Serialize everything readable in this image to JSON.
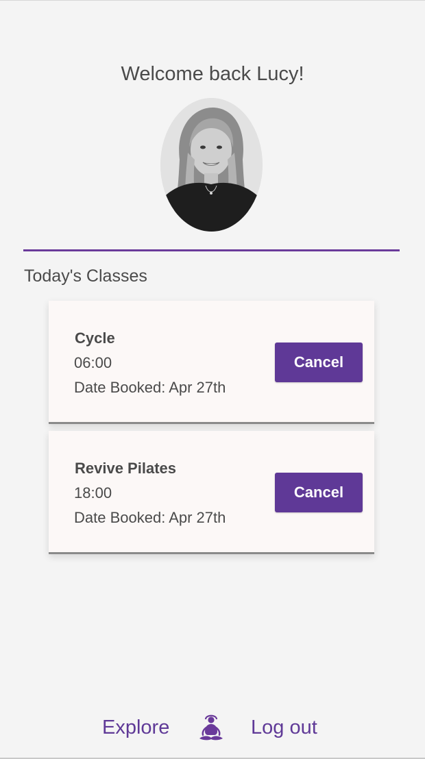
{
  "header": {
    "welcome_text": "Welcome back Lucy!",
    "avatar_alt": "Profile photo of Lucy"
  },
  "classes_section": {
    "title": "Today's Classes",
    "items": [
      {
        "name": "Cycle",
        "time": "06:00",
        "date_booked": "Date Booked: Apr 27th",
        "cancel_label": "Cancel"
      },
      {
        "name": "Revive Pilates",
        "time": "18:00",
        "date_booked": "Date Booked: Apr 27th",
        "cancel_label": "Cancel"
      }
    ]
  },
  "footer": {
    "explore_label": "Explore",
    "logout_label": "Log out",
    "logo_icon": "meditation-figure-icon"
  },
  "colors": {
    "accent": "#5f3997",
    "divider": "#6a3a9a",
    "card_bg": "#fcf8f7",
    "page_bg": "#f4f4f4"
  }
}
